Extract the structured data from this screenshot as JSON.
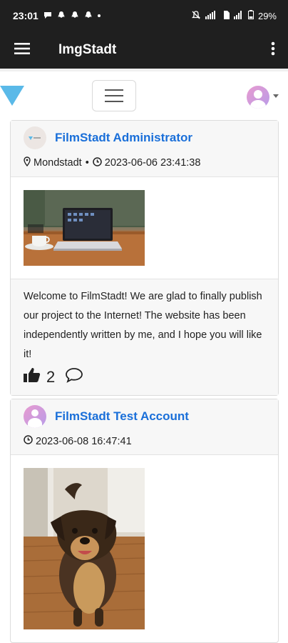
{
  "status_bar": {
    "time": "23:01",
    "battery": "29%"
  },
  "app_bar": {
    "title": "ImgStadt"
  },
  "posts": [
    {
      "author": "FilmStadt Administrator",
      "location": "Mondstadt",
      "separator": "•",
      "timestamp": "2023-06-06 23:41:38",
      "text": "Welcome to FilmStadt! We are glad to finally publish our project to the Internet! The website has been independently written by me, and I hope you will like it!",
      "likes": "2"
    },
    {
      "author": "FilmStadt Test Account",
      "timestamp": "2023-06-08 16:47:41"
    }
  ],
  "icons": {
    "menu": "hamburger-menu-icon",
    "overflow": "more-vert-icon",
    "location": "map-marker-icon",
    "clock": "clock-icon",
    "like": "thumbs-up-icon",
    "comment": "speech-bubble-icon"
  },
  "colors": {
    "app_bar": "#1f1f1f",
    "link": "#1a6fd9",
    "logo": "#5ab9e8",
    "card_header": "#f7f7f7"
  }
}
